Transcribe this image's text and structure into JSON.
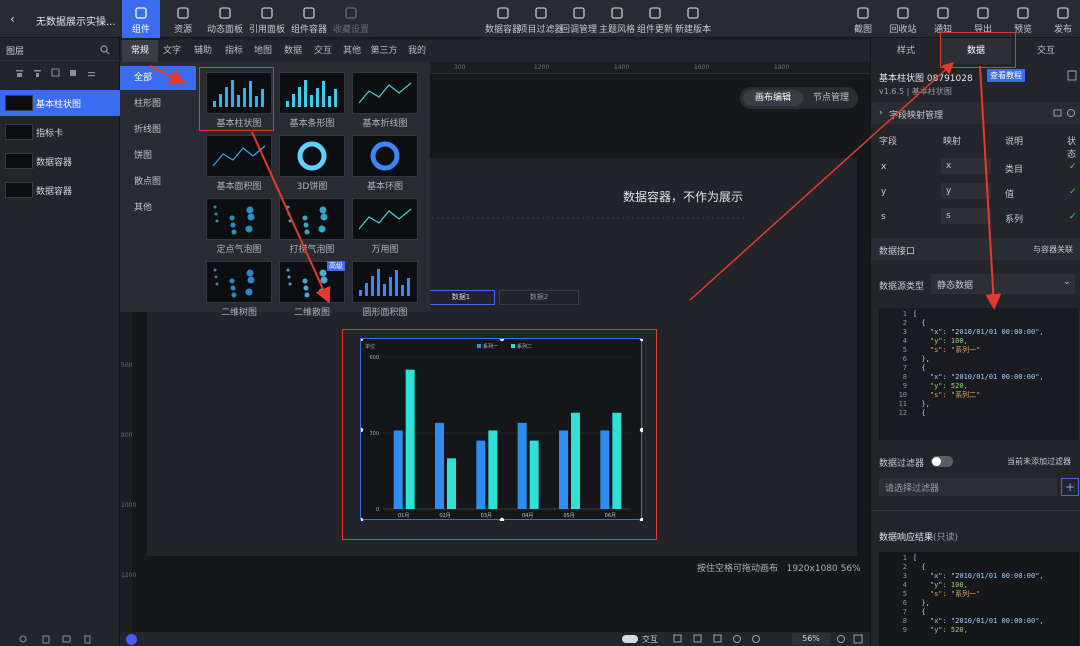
{
  "app": {
    "title": "无数据展示实操..."
  },
  "toolbar": {
    "left": [
      {
        "label": "组件",
        "icon": "component-icon",
        "active": true
      },
      {
        "label": "资源",
        "icon": "layers-icon"
      },
      {
        "label": "动态面板",
        "icon": "panel-icon"
      },
      {
        "label": "引用面板",
        "icon": "link-icon"
      },
      {
        "label": "组件容器",
        "icon": "container-icon"
      },
      {
        "label": "收藏设置",
        "icon": "copy-icon",
        "dim": true
      }
    ],
    "center": [
      {
        "label": "数据容器",
        "icon": "barcode-icon"
      },
      {
        "label": "项目过滤器",
        "icon": "filter-icon"
      },
      {
        "label": "回调管理",
        "icon": "sliders-icon"
      },
      {
        "label": "主题风格",
        "icon": "palette-icon"
      },
      {
        "label": "组件更新",
        "icon": "refresh-icon"
      },
      {
        "label": "新建版本",
        "icon": "checkbox-icon"
      }
    ],
    "right": [
      {
        "label": "截图",
        "icon": "crop-icon"
      },
      {
        "label": "回收站",
        "icon": "trash-icon"
      },
      {
        "label": "通知",
        "icon": "bell-icon"
      },
      {
        "label": "导出",
        "icon": "export-icon"
      },
      {
        "label": "预览",
        "icon": "eye-icon"
      },
      {
        "label": "发布",
        "icon": "send-icon"
      }
    ]
  },
  "left_panel": {
    "title": "图层",
    "layers": [
      "基本柱状图",
      "指标卡",
      "数据容器",
      "数据容器"
    ]
  },
  "categories": [
    "常规",
    "文字",
    "辅助",
    "指标",
    "地图",
    "数据",
    "交互",
    "其他",
    "第三方",
    "我的"
  ],
  "subcategories": [
    "全部",
    "柱形图",
    "折线图",
    "饼图",
    "散点图",
    "其他"
  ],
  "gallery": [
    {
      "label": "基本柱状图",
      "selected": true
    },
    {
      "label": "基本条形图"
    },
    {
      "label": "基本折线图"
    },
    {
      "label": "基本面积图"
    },
    {
      "label": "3D饼图"
    },
    {
      "label": "基本环图"
    },
    {
      "label": "定点气泡图"
    },
    {
      "label": "打捞气泡图"
    },
    {
      "label": "万用图"
    },
    {
      "label": "二维树图"
    },
    {
      "label": "二维散图",
      "badge": "高级"
    },
    {
      "label": "圆形面积图"
    }
  ],
  "canvas": {
    "mode_buttons": [
      "画布编辑",
      "节点管理"
    ],
    "container_text": "数据容器，不作为展示",
    "data_tabs": [
      "数据1",
      "数据2"
    ],
    "ruler_top": [
      "300",
      "1200",
      "1400",
      "1600",
      "1800"
    ],
    "ruler_left": [
      "500",
      "800",
      "1000",
      "1200"
    ],
    "status": "按住空格可拖动画布",
    "size": "1920x1080",
    "zoom": "56%"
  },
  "chart_data": {
    "type": "bar",
    "categories": [
      "01月",
      "02月",
      "03月",
      "04月",
      "05月",
      "06月"
    ],
    "series": [
      {
        "name": "系列一",
        "values": [
          310,
          340,
          270,
          340,
          310,
          310
        ]
      },
      {
        "name": "系列二",
        "values": [
          550,
          200,
          310,
          270,
          380,
          380
        ]
      }
    ],
    "ylim": [
      0,
      600
    ],
    "yticks": [
      "600",
      "300",
      "0"
    ],
    "ylabel": "单位",
    "colors": [
      "#2f8cf0",
      "#2fe0d5"
    ],
    "legend": "top-center"
  },
  "bottom": {
    "interact": "交互",
    "zoom": "56%"
  },
  "right_panel": {
    "tabs": [
      "样式",
      "数据",
      "交互"
    ],
    "component_name": "基本柱状图",
    "component_id": "08791028",
    "tutorial": "查看教程",
    "version": "v1.6.5",
    "component_type": "基本柱状图",
    "mapping_title": "字段映射管理",
    "mapping_headers": [
      "字段",
      "映射",
      "说明",
      "状态"
    ],
    "mapping_rows": [
      {
        "field": "x",
        "map": "x",
        "desc": "类目"
      },
      {
        "field": "y",
        "map": "y",
        "desc": "值"
      },
      {
        "field": "s",
        "map": "s",
        "desc": "系列"
      }
    ],
    "interface_title": "数据接口",
    "interface_right": "与容器关联",
    "source_label": "数据源类型",
    "source_value": "静态数据",
    "code_lines": [
      "[",
      "  {",
      "    \"x\": \"2010/01/01 00:00:00\",",
      "    \"y\": 100,",
      "    \"s\": \"系列一\"",
      "  },",
      "  {",
      "    \"x\": \"2010/01/01 00:00:00\",",
      "    \"y\": 520,",
      "    \"s\": \"系列二\"",
      "  },",
      "  {"
    ],
    "filter_label": "数据过滤器",
    "filter_right": "当前未添加过滤器",
    "filter_select": "请选择过滤器",
    "result_title": "数据响应结果",
    "result_note": "(只读)",
    "result_lines": [
      "[",
      "  {",
      "    \"x\": \"2010/01/01 00:00:00\",",
      "    \"y\": 100,",
      "    \"s\": \"系列一\"",
      "  },",
      "  {",
      "    \"x\": \"2010/01/01 00:00:00\",",
      "    \"y\": 520,"
    ]
  }
}
